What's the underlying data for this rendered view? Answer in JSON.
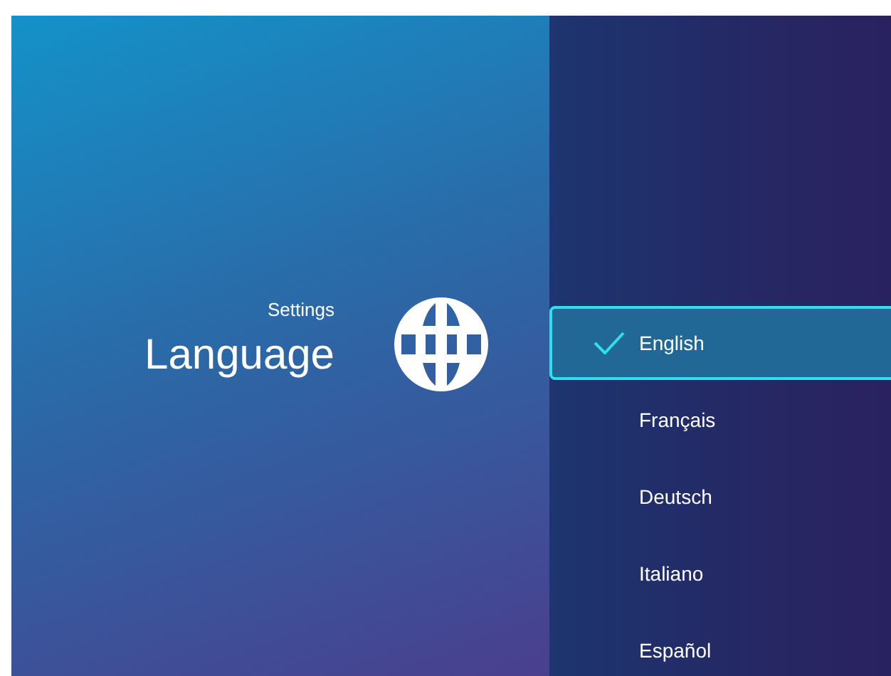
{
  "header": {
    "breadcrumb": "Settings",
    "title": "Language"
  },
  "languages": [
    {
      "label": "English",
      "selected": true
    },
    {
      "label": "Français",
      "selected": false
    },
    {
      "label": "Deutsch",
      "selected": false
    },
    {
      "label": "Italiano",
      "selected": false
    },
    {
      "label": "Español",
      "selected": false
    }
  ]
}
